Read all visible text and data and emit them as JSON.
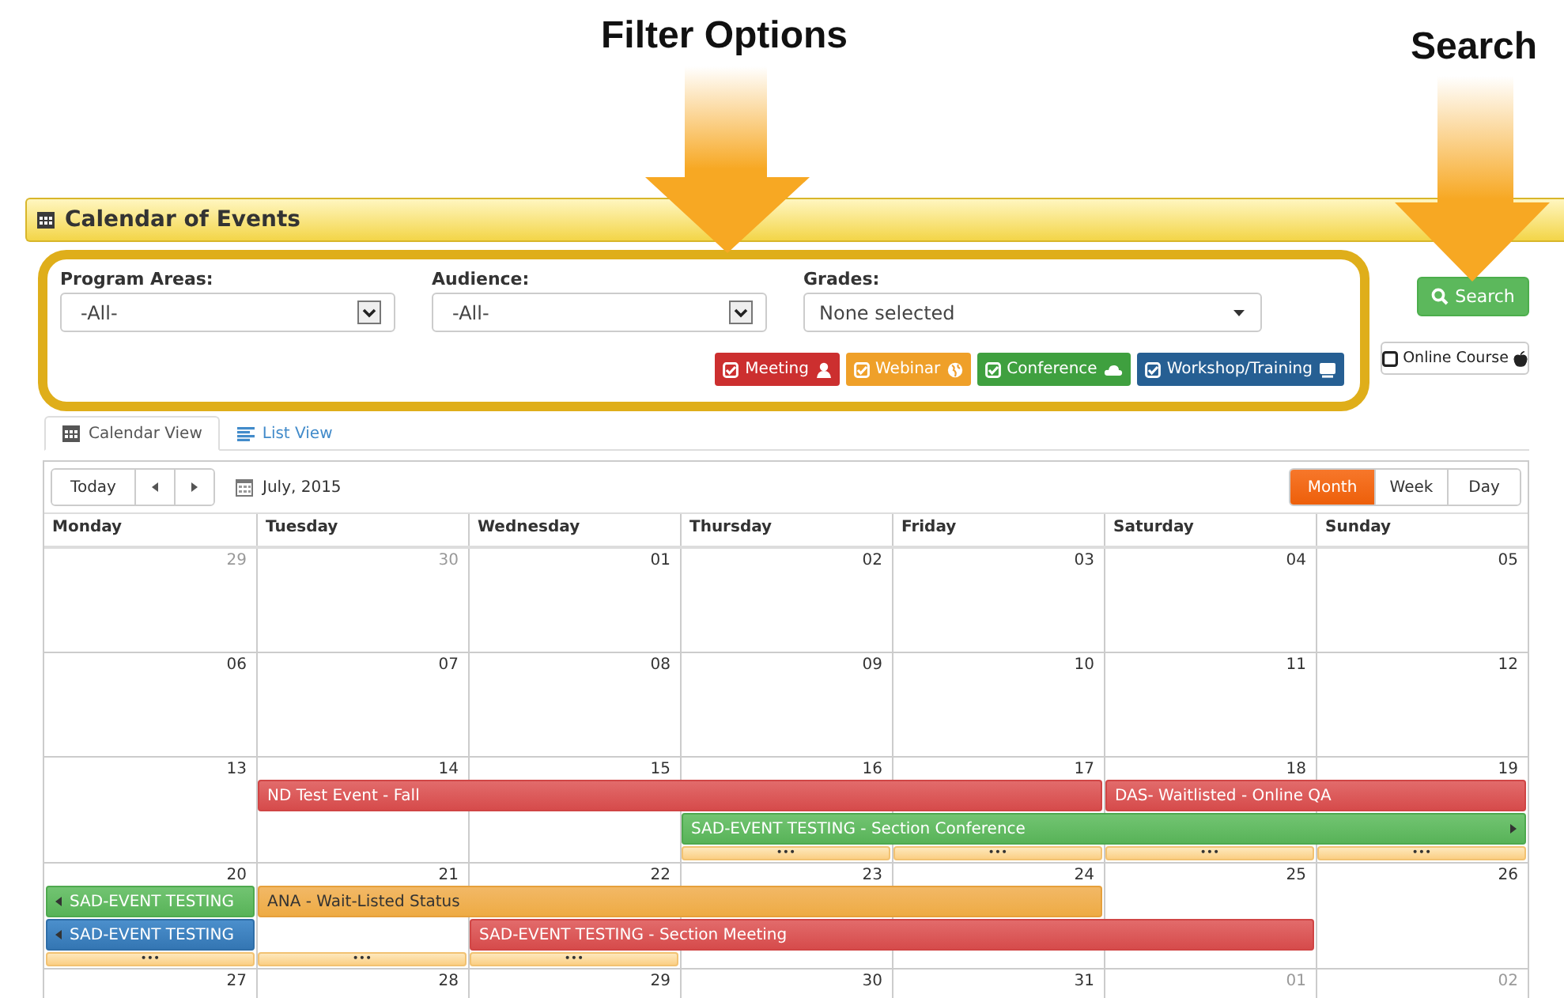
{
  "annotations": [
    {
      "label": "Filter Options",
      "kind": "filters"
    },
    {
      "label": "Search",
      "kind": "search"
    }
  ],
  "header": {
    "title": "Calendar of Events"
  },
  "filters": [
    {
      "kind": "select",
      "label": "Program Areas:",
      "value": "-All-"
    },
    {
      "kind": "select",
      "label": "Audience:",
      "value": "-All-"
    },
    {
      "kind": "multiselect",
      "label": "Grades:",
      "value": "None selected"
    }
  ],
  "categories": [
    {
      "label": "Meeting",
      "kind": "meeting",
      "checked": true
    },
    {
      "label": "Webinar",
      "kind": "webinar",
      "checked": true
    },
    {
      "label": "Conference",
      "kind": "conference",
      "checked": true
    },
    {
      "label": "Workshop/Training",
      "kind": "workshop",
      "checked": true
    }
  ],
  "search_button": {
    "label": "Search"
  },
  "online_course": {
    "label": "Online Course",
    "checked": false
  },
  "tabs": [
    {
      "label": "Calendar View",
      "kind": "calendar",
      "selected": true
    },
    {
      "label": "List View",
      "kind": "list",
      "selected": false
    }
  ],
  "toolbar": {
    "today": "Today",
    "period": "July, 2015",
    "views": [
      {
        "label": "Month",
        "selected": true
      },
      {
        "label": "Week",
        "selected": false
      },
      {
        "label": "Day",
        "selected": false
      }
    ]
  },
  "weekdays": [
    "Monday",
    "Tuesday",
    "Wednesday",
    "Thursday",
    "Friday",
    "Saturday",
    "Sunday"
  ],
  "weeks": [
    {
      "days": [
        {
          "date": "29",
          "muted": true
        },
        {
          "date": "30",
          "muted": true
        },
        {
          "date": "01",
          "muted": false
        },
        {
          "date": "02",
          "muted": false
        },
        {
          "date": "03",
          "muted": false
        },
        {
          "date": "04",
          "muted": false
        },
        {
          "date": "05",
          "muted": false
        }
      ]
    },
    {
      "days": [
        {
          "date": "06",
          "muted": false
        },
        {
          "date": "07",
          "muted": false
        },
        {
          "date": "08",
          "muted": false
        },
        {
          "date": "09",
          "muted": false
        },
        {
          "date": "10",
          "muted": false
        },
        {
          "date": "11",
          "muted": false
        },
        {
          "date": "12",
          "muted": false
        }
      ]
    },
    {
      "days": [
        {
          "date": "13",
          "muted": false
        },
        {
          "date": "14",
          "muted": false
        },
        {
          "date": "15",
          "muted": false
        },
        {
          "date": "16",
          "muted": false
        },
        {
          "date": "17",
          "muted": false
        },
        {
          "date": "18",
          "muted": false
        },
        {
          "date": "19",
          "muted": false
        }
      ],
      "lanes": [
        [
          {
            "kind": "empty"
          },
          {
            "kind": "meeting",
            "title": "ND Test Event - Fall",
            "continues_before": false,
            "continues_after": false
          },
          {
            "kind": "continued"
          },
          {
            "kind": "continued"
          },
          {
            "kind": "continued"
          },
          {
            "kind": "meeting",
            "title": "DAS- Waitlisted - Online QA",
            "continues_before": false,
            "continues_after": false
          },
          {
            "kind": "continued"
          }
        ],
        [
          {
            "kind": "empty"
          },
          {
            "kind": "empty"
          },
          {
            "kind": "empty"
          },
          {
            "kind": "conference",
            "title": "SAD-EVENT TESTING - Section Conference",
            "continues_before": false,
            "continues_after": true
          },
          {
            "kind": "continued"
          },
          {
            "kind": "continued"
          },
          {
            "kind": "continued"
          }
        ],
        [
          {
            "kind": "empty"
          },
          {
            "kind": "empty"
          },
          {
            "kind": "empty"
          },
          {
            "kind": "more",
            "title": "•••"
          },
          {
            "kind": "more",
            "title": "•••"
          },
          {
            "kind": "more",
            "title": "•••"
          },
          {
            "kind": "more",
            "title": "•••"
          }
        ]
      ]
    },
    {
      "days": [
        {
          "date": "20",
          "muted": false
        },
        {
          "date": "21",
          "muted": false
        },
        {
          "date": "22",
          "muted": false
        },
        {
          "date": "23",
          "muted": false
        },
        {
          "date": "24",
          "muted": false
        },
        {
          "date": "25",
          "muted": false
        },
        {
          "date": "26",
          "muted": false
        }
      ],
      "lanes": [
        [
          {
            "kind": "conference",
            "title": "SAD-EVENT TESTING",
            "continues_before": true,
            "continues_after": false
          },
          {
            "kind": "webinar",
            "title": "ANA - Wait-Listed Status",
            "continues_before": false,
            "continues_after": false
          },
          {
            "kind": "continued"
          },
          {
            "kind": "continued"
          },
          {
            "kind": "continued"
          },
          {
            "kind": "empty"
          },
          {
            "kind": "empty"
          }
        ],
        [
          {
            "kind": "workshop",
            "title": "SAD-EVENT TESTING",
            "continues_before": true,
            "continues_after": false
          },
          {
            "kind": "empty"
          },
          {
            "kind": "meeting",
            "title": "SAD-EVENT TESTING - Section Meeting",
            "continues_before": false,
            "continues_after": false
          },
          {
            "kind": "continued"
          },
          {
            "kind": "continued"
          },
          {
            "kind": "continued"
          },
          {
            "kind": "empty"
          }
        ],
        [
          {
            "kind": "more",
            "title": "•••"
          },
          {
            "kind": "more",
            "title": "•••"
          },
          {
            "kind": "more",
            "title": "•••"
          },
          {
            "kind": "empty"
          },
          {
            "kind": "empty"
          },
          {
            "kind": "empty"
          },
          {
            "kind": "empty"
          }
        ]
      ]
    },
    {
      "days": [
        {
          "date": "27",
          "muted": false
        },
        {
          "date": "28",
          "muted": false
        },
        {
          "date": "29",
          "muted": false
        },
        {
          "date": "30",
          "muted": false
        },
        {
          "date": "31",
          "muted": false
        },
        {
          "date": "01",
          "muted": true
        },
        {
          "date": "02",
          "muted": true
        }
      ]
    }
  ]
}
